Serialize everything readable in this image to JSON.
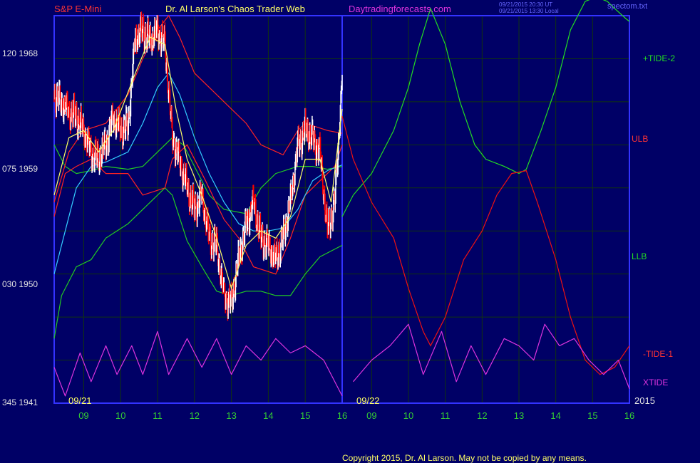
{
  "header": {
    "symbol": "S&P E-Mini",
    "title": "Dr. Al Larson's Chaos Trader Web",
    "site": "Daytradingforecasts.com",
    "stamp_line1": "09/21/2015 20:30 UT",
    "stamp_line2": "09/21/2015 13:30 Local",
    "filename": "spectom.txt"
  },
  "footer": {
    "copyright": "Copyright 2015, Dr. Al Larson. May not be copied by any means."
  },
  "colors": {
    "background": "#000066",
    "axes": "#3333ff",
    "grid": "#113311",
    "price": "#ffffff",
    "down_bars": "#ff0000",
    "ulb_llb": "#ff2222",
    "green_band": "#22cc22",
    "cyan_avg": "#33ccff",
    "yellow_avg": "#ffff66",
    "tide_plus": "#22dd22",
    "tide_minus": "#ee1111",
    "xtide": "#dd33dd",
    "label_red": "#ff3333",
    "label_green": "#22dd22",
    "label_magenta": "#dd33dd",
    "tick_green": "#33cc33",
    "date_yellow": "#ffff66"
  },
  "chart_data": {
    "type": "line",
    "title": "S&P E-Mini",
    "y_left": {
      "ticks": [
        {
          "value": 1968,
          "label": "120  1968"
        },
        {
          "value": 1959,
          "label": "075  1959"
        },
        {
          "value": 1950,
          "label": "030  1950"
        },
        {
          "value": 1941,
          "label": "345  1941"
        }
      ],
      "ylim": [
        1941,
        1968
      ]
    },
    "x": {
      "hours": [
        8.2,
        16.0,
        8.2,
        16.0
      ],
      "tick_labels": [
        "09",
        "10",
        "11",
        "12",
        "13",
        "14",
        "15",
        "16",
        "09",
        "10",
        "11",
        "12",
        "13",
        "14",
        "15",
        "16"
      ],
      "date_labels": [
        "09/21",
        "09/22"
      ],
      "year_label": "2015",
      "session_divider_after": "16"
    },
    "grid": true,
    "series_labels": {
      "tide_plus": "+TIDE-2",
      "ulb": "ULB",
      "llb": "LLB",
      "tide_minus": "-TIDE-1",
      "xtide": "XTIDE"
    },
    "price_close": [
      [
        8.2,
        1962.5
      ],
      [
        8.4,
        1962
      ],
      [
        8.6,
        1961.3
      ],
      [
        8.8,
        1961
      ],
      [
        9.0,
        1960
      ],
      [
        9.2,
        1958.5
      ],
      [
        9.4,
        1958
      ],
      [
        9.6,
        1959
      ],
      [
        9.8,
        1961
      ],
      [
        10.0,
        1960
      ],
      [
        10.2,
        1960.3
      ],
      [
        10.4,
        1966.5
      ],
      [
        10.6,
        1967
      ],
      [
        10.8,
        1966.3
      ],
      [
        11.0,
        1967
      ],
      [
        11.2,
        1966
      ],
      [
        11.4,
        1959.5
      ],
      [
        11.6,
        1958
      ],
      [
        11.8,
        1956
      ],
      [
        12.0,
        1954.5
      ],
      [
        12.2,
        1955.5
      ],
      [
        12.4,
        1952.5
      ],
      [
        12.6,
        1952
      ],
      [
        12.8,
        1948.5
      ],
      [
        13.0,
        1948
      ],
      [
        13.2,
        1951
      ],
      [
        13.4,
        1953.5
      ],
      [
        13.6,
        1955
      ],
      [
        13.8,
        1952.5
      ],
      [
        14.0,
        1952
      ],
      [
        14.2,
        1951
      ],
      [
        14.4,
        1952.5
      ],
      [
        14.6,
        1955
      ],
      [
        14.8,
        1959
      ],
      [
        15.0,
        1960
      ],
      [
        15.2,
        1959.5
      ],
      [
        15.4,
        1958.5
      ],
      [
        15.6,
        1953
      ],
      [
        15.8,
        1955
      ],
      [
        16.0,
        1963.5
      ]
    ],
    "ulb": [
      [
        8.2,
        1955
      ],
      [
        8.6,
        1958.5
      ],
      [
        9.0,
        1960
      ],
      [
        9.6,
        1960.5
      ],
      [
        10.2,
        1962.5
      ],
      [
        10.6,
        1965
      ],
      [
        11.0,
        1967
      ],
      [
        11.3,
        1968
      ],
      [
        11.6,
        1966.5
      ],
      [
        12.0,
        1964
      ],
      [
        12.4,
        1963
      ],
      [
        12.8,
        1962
      ],
      [
        13.4,
        1960.5
      ],
      [
        13.8,
        1959
      ],
      [
        14.4,
        1958.3
      ],
      [
        14.8,
        1960
      ],
      [
        15.0,
        1960.5
      ],
      [
        15.6,
        1960
      ],
      [
        16.0,
        1959.8
      ]
    ],
    "llb": [
      [
        8.2,
        1954
      ],
      [
        8.5,
        1957
      ],
      [
        8.8,
        1957.5
      ],
      [
        9.2,
        1958
      ],
      [
        9.6,
        1957
      ],
      [
        10.2,
        1957
      ],
      [
        10.6,
        1955.5
      ],
      [
        11.2,
        1956
      ],
      [
        11.4,
        1958
      ],
      [
        11.8,
        1959
      ],
      [
        12.3,
        1956.5
      ],
      [
        12.8,
        1953.8
      ],
      [
        13.2,
        1952.5
      ],
      [
        13.6,
        1950.5
      ],
      [
        14.2,
        1950
      ],
      [
        14.6,
        1952.5
      ],
      [
        15.0,
        1955.5
      ],
      [
        15.4,
        1956.5
      ],
      [
        15.8,
        1957.5
      ],
      [
        16.0,
        1959
      ]
    ],
    "green_upper": [
      [
        8.2,
        1959
      ],
      [
        8.5,
        1957.5
      ],
      [
        8.8,
        1957
      ],
      [
        9.2,
        1957.2
      ],
      [
        9.6,
        1957.5
      ],
      [
        10.2,
        1957.3
      ],
      [
        10.6,
        1957.5
      ],
      [
        11.0,
        1958.5
      ],
      [
        11.4,
        1959.5
      ],
      [
        11.7,
        1959
      ],
      [
        12.0,
        1957.5
      ],
      [
        12.4,
        1955.5
      ],
      [
        12.8,
        1954.5
      ],
      [
        13.4,
        1954.2
      ],
      [
        13.8,
        1956
      ],
      [
        14.2,
        1957
      ],
      [
        14.8,
        1957.5
      ],
      [
        15.2,
        1957.5
      ],
      [
        15.6,
        1957.3
      ],
      [
        16.0,
        1957.5
      ]
    ],
    "green_lower": [
      [
        8.2,
        1945.5
      ],
      [
        8.4,
        1948.5
      ],
      [
        8.8,
        1950.5
      ],
      [
        9.2,
        1951
      ],
      [
        9.6,
        1952.5
      ],
      [
        10.2,
        1953.5
      ],
      [
        10.8,
        1955
      ],
      [
        11.2,
        1956
      ],
      [
        11.4,
        1955.5
      ],
      [
        11.8,
        1952.3
      ],
      [
        12.2,
        1950.5
      ],
      [
        12.6,
        1948.8
      ],
      [
        13.0,
        1948.5
      ],
      [
        13.4,
        1948.8
      ],
      [
        13.8,
        1948.8
      ],
      [
        14.2,
        1948.5
      ],
      [
        14.6,
        1948.5
      ],
      [
        15.0,
        1950
      ],
      [
        15.4,
        1951.2
      ],
      [
        16.0,
        1952
      ]
    ],
    "cyan_avg": [
      [
        8.2,
        1950
      ],
      [
        8.5,
        1953
      ],
      [
        8.8,
        1956
      ],
      [
        9.2,
        1957.5
      ],
      [
        9.6,
        1957.8
      ],
      [
        10.2,
        1958.5
      ],
      [
        10.6,
        1960.5
      ],
      [
        11.0,
        1963
      ],
      [
        11.3,
        1964
      ],
      [
        11.6,
        1962.5
      ],
      [
        12.0,
        1959.5
      ],
      [
        12.4,
        1957
      ],
      [
        12.8,
        1955
      ],
      [
        13.2,
        1953.5
      ],
      [
        13.6,
        1953
      ],
      [
        14.0,
        1953
      ],
      [
        14.4,
        1953.2
      ],
      [
        14.8,
        1954.5
      ],
      [
        15.2,
        1956.5
      ],
      [
        15.6,
        1957.2
      ],
      [
        16.0,
        1957.6
      ]
    ],
    "yellow_avg": [
      [
        8.2,
        1955.5
      ],
      [
        8.6,
        1959.5
      ],
      [
        9.0,
        1960
      ],
      [
        9.4,
        1958.5
      ],
      [
        9.8,
        1960
      ],
      [
        10.4,
        1964
      ],
      [
        10.8,
        1966.5
      ],
      [
        11.2,
        1966
      ],
      [
        11.5,
        1961.5
      ],
      [
        11.8,
        1958
      ],
      [
        12.2,
        1955.5
      ],
      [
        12.6,
        1952.5
      ],
      [
        13.0,
        1949
      ],
      [
        13.4,
        1952
      ],
      [
        13.8,
        1953
      ],
      [
        14.2,
        1952.5
      ],
      [
        14.6,
        1954
      ],
      [
        15.0,
        1958
      ],
      [
        15.4,
        1958
      ],
      [
        15.7,
        1955
      ],
      [
        16.0,
        1961.5
      ]
    ],
    "tide_plus_2": [
      [
        8.2,
        1954
      ],
      [
        8.5,
        1955.5
      ],
      [
        9.0,
        1957
      ],
      [
        9.6,
        1960
      ],
      [
        10.0,
        1963
      ],
      [
        10.3,
        1966
      ],
      [
        10.6,
        1968.5
      ],
      [
        11.0,
        1966
      ],
      [
        11.4,
        1962
      ],
      [
        11.8,
        1959
      ],
      [
        12.1,
        1958
      ],
      [
        12.6,
        1957.5
      ],
      [
        13.0,
        1957
      ],
      [
        13.2,
        1957.3
      ],
      [
        13.6,
        1960
      ],
      [
        14.0,
        1963
      ],
      [
        14.4,
        1967
      ],
      [
        14.8,
        1969
      ],
      [
        15.1,
        1969.3
      ],
      [
        15.4,
        1969
      ],
      [
        15.6,
        1968.5
      ],
      [
        15.9,
        1967.8
      ],
      [
        16.0,
        1967.6
      ]
    ],
    "tide_minus_1": [
      [
        8.2,
        1961
      ],
      [
        8.5,
        1958
      ],
      [
        9.0,
        1955
      ],
      [
        9.6,
        1952.5
      ],
      [
        10.0,
        1949
      ],
      [
        10.4,
        1946
      ],
      [
        10.6,
        1945
      ],
      [
        11.0,
        1947
      ],
      [
        11.5,
        1951
      ],
      [
        12.0,
        1953
      ],
      [
        12.4,
        1955.5
      ],
      [
        12.8,
        1957
      ],
      [
        13.2,
        1957.2
      ],
      [
        13.5,
        1955
      ],
      [
        14.0,
        1951
      ],
      [
        14.4,
        1947
      ],
      [
        14.8,
        1944
      ],
      [
        15.2,
        1943
      ],
      [
        15.6,
        1943.5
      ],
      [
        16.0,
        1945
      ]
    ],
    "xtide": [
      [
        8.2,
        1943.5
      ],
      [
        8.5,
        1941.5
      ],
      [
        8.9,
        1944.5
      ],
      [
        9.2,
        1942.5
      ],
      [
        9.6,
        1945
      ],
      [
        9.9,
        1943
      ],
      [
        10.3,
        1945
      ],
      [
        10.6,
        1943
      ],
      [
        11.0,
        1946
      ],
      [
        11.3,
        1943
      ],
      [
        11.8,
        1945.5
      ],
      [
        12.2,
        1943.5
      ],
      [
        12.6,
        1945.5
      ],
      [
        13.0,
        1943
      ],
      [
        13.4,
        1945
      ],
      [
        13.8,
        1944
      ],
      [
        14.2,
        1945.5
      ],
      [
        14.6,
        1944.5
      ],
      [
        15.0,
        1945
      ],
      [
        15.5,
        1944
      ],
      [
        16.0,
        1941.5
      ],
      [
        8.5,
        1942.5
      ],
      [
        9.0,
        1944
      ],
      [
        9.5,
        1945
      ],
      [
        10.0,
        1946.5
      ],
      [
        10.4,
        1943
      ],
      [
        10.9,
        1946
      ],
      [
        11.3,
        1942.5
      ],
      [
        11.7,
        1945
      ],
      [
        12.1,
        1943
      ],
      [
        12.6,
        1945.5
      ],
      [
        13.0,
        1945
      ],
      [
        13.4,
        1944
      ],
      [
        13.7,
        1946.5
      ],
      [
        14.1,
        1945
      ],
      [
        14.5,
        1945.5
      ],
      [
        14.9,
        1944
      ],
      [
        15.3,
        1943
      ],
      [
        15.7,
        1944
      ],
      [
        16.0,
        1942
      ]
    ]
  }
}
